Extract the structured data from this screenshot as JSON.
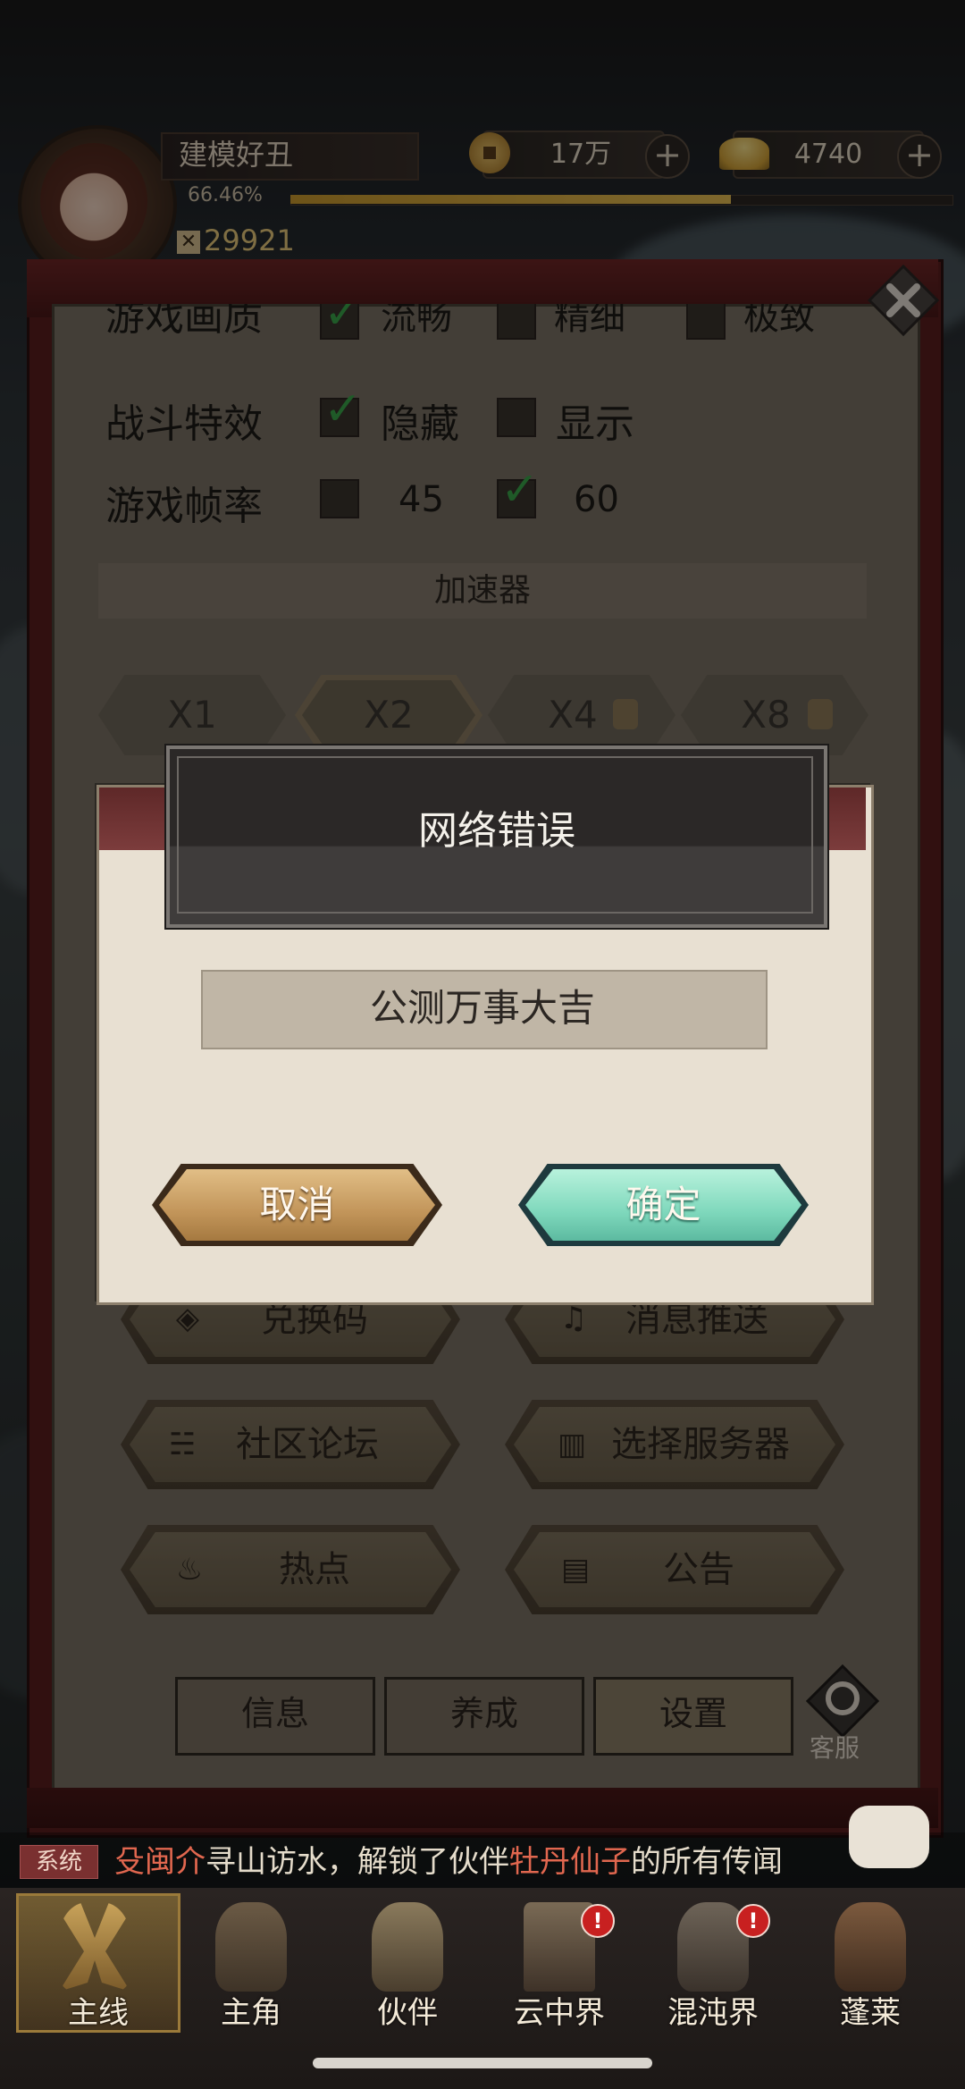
{
  "header": {
    "player_name": "建模好丑",
    "exp_percent": "66.46%",
    "exp_fraction": 0.6646,
    "power": "29921",
    "coins": "17万",
    "ingots": "4740",
    "plus_symbol": "+"
  },
  "settings": {
    "rows": [
      {
        "label": "游戏画质",
        "options": [
          {
            "value": "流畅",
            "checked": true
          },
          {
            "value": "精细",
            "checked": false
          },
          {
            "value": "极致",
            "checked": false
          }
        ]
      },
      {
        "label": "战斗特效",
        "options": [
          {
            "value": "隐藏",
            "checked": true
          },
          {
            "value": "显示",
            "checked": false
          }
        ]
      },
      {
        "label": "游戏帧率",
        "options": [
          {
            "value": "45",
            "checked": false
          },
          {
            "value": "60",
            "checked": true
          }
        ]
      }
    ],
    "accelerator_label": "加速器",
    "speeds": [
      {
        "label": "X1",
        "selected": false,
        "locked": false
      },
      {
        "label": "X2",
        "selected": true,
        "locked": false
      },
      {
        "label": "X4",
        "selected": false,
        "locked": true
      },
      {
        "label": "X8",
        "selected": false,
        "locked": true
      }
    ],
    "menu_buttons": [
      "兑换码",
      "消息推送",
      "社区论坛",
      "选择服务器",
      "热点",
      "公告"
    ],
    "tabs": [
      "信息",
      "养成",
      "设置"
    ],
    "customer_service": "客服"
  },
  "dialog": {
    "title": "网络错误",
    "message": "公测万事大吉",
    "cancel_label": "取消",
    "ok_label": "确定"
  },
  "chat": {
    "tag": "系统",
    "name": "殳闽介",
    "text1": "寻山访水，解锁了伙伴",
    "partner": "牡丹仙子",
    "text2": "的所有传闻"
  },
  "nav": {
    "items": [
      {
        "label": "主线",
        "active": true,
        "badge": false
      },
      {
        "label": "主角",
        "active": false,
        "badge": false
      },
      {
        "label": "伙伴",
        "active": false,
        "badge": false
      },
      {
        "label": "云中界",
        "active": false,
        "badge": true
      },
      {
        "label": "混沌界",
        "active": false,
        "badge": true
      },
      {
        "label": "蓬莱",
        "active": false,
        "badge": false
      }
    ],
    "badge_symbol": "!"
  },
  "colors": {
    "panel_frame": "#5a1e1e",
    "check_green": "#3aa54a",
    "cancel_gold": "#c2955a",
    "ok_teal": "#7fd8bc",
    "chat_highlight": "#e1674f"
  }
}
